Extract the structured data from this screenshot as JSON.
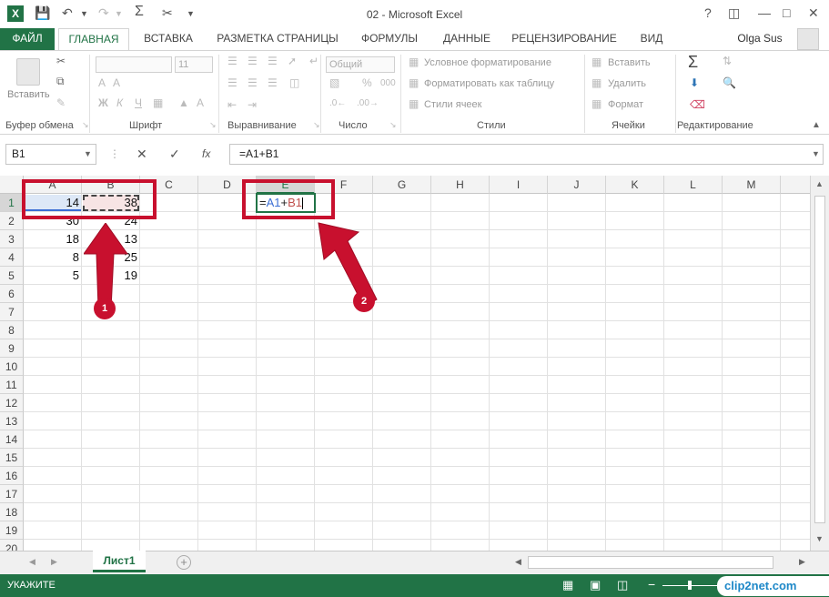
{
  "window": {
    "title": "02 - Microsoft Excel",
    "help": "?",
    "user": "Olga Sus"
  },
  "tabs": [
    "ФАЙЛ",
    "ГЛАВНАЯ",
    "ВСТАВКА",
    "РАЗМЕТКА СТРАНИЦЫ",
    "ФОРМУЛЫ",
    "ДАННЫЕ",
    "РЕЦЕНЗИРОВАНИЕ",
    "ВИД"
  ],
  "ribbon": {
    "paste_label": "Вставить",
    "groups": [
      "Буфер обмена",
      "Шрифт",
      "Выравнивание",
      "Число",
      "Стили",
      "Ячейки",
      "Редактирование"
    ],
    "font_size": "11",
    "number_format": "Общий",
    "styles": [
      "Условное форматирование",
      "Форматировать как таблицу",
      "Стили ячеек"
    ],
    "cells": [
      "Вставить",
      "Удалить",
      "Формат"
    ],
    "number_buttons": {
      "percent": "%",
      "thousands": "000"
    }
  },
  "formula_bar": {
    "name_box": "B1",
    "formula": "=A1+B1",
    "fx": "fx"
  },
  "columns": [
    "A",
    "B",
    "C",
    "D",
    "E",
    "F",
    "G",
    "H",
    "I",
    "J",
    "K",
    "L",
    "M"
  ],
  "rows": [
    "1",
    "2",
    "3",
    "4",
    "5",
    "6",
    "7",
    "8",
    "9",
    "10",
    "11",
    "12",
    "13",
    "14",
    "15",
    "16",
    "17",
    "18",
    "19",
    "20"
  ],
  "cells": {
    "A": [
      "14",
      "30",
      "18",
      "8",
      "5"
    ],
    "B": [
      "38",
      "24",
      "13",
      "25",
      "19"
    ]
  },
  "editing_cell": {
    "prefix": "=",
    "ref1": "A1",
    "plus": "+",
    "ref2": "B1"
  },
  "sheet_tab": "Лист1",
  "status": {
    "mode": "УКАЖИТЕ",
    "watermark": "clip2net.com"
  },
  "annotations": [
    "1",
    "2"
  ],
  "colors": {
    "excel_green": "#217346",
    "annotation_red": "#c8102e",
    "ref_blue": "#3b6ed4",
    "ref_red": "#c0504d"
  }
}
